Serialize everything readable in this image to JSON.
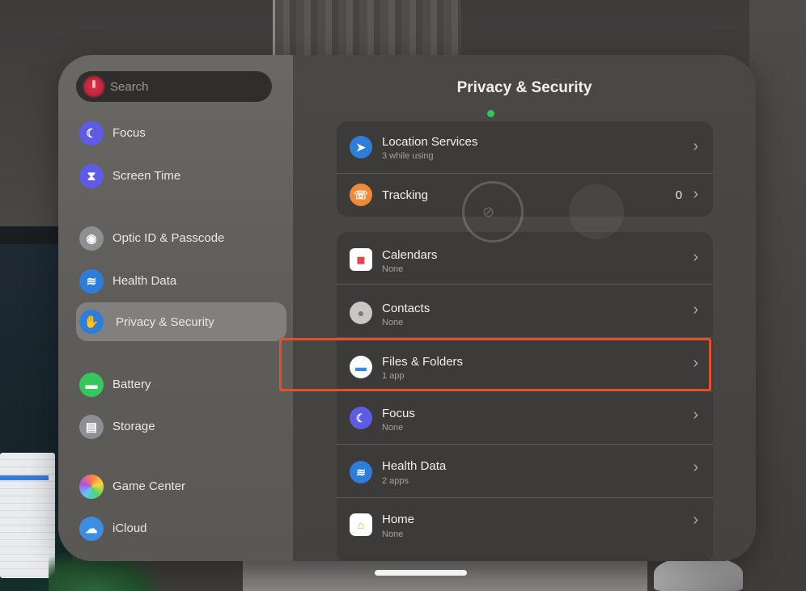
{
  "search": {
    "placeholder": "Search"
  },
  "sidebar": {
    "items": [
      {
        "label": "Focus",
        "icon": "moon-icon",
        "color": "#5e5ce6"
      },
      {
        "label": "Screen Time",
        "icon": "hourglass-icon",
        "color": "#5e5ce6"
      },
      {
        "label": "Optic ID & Passcode",
        "icon": "optic-id-icon",
        "color": "#8e8e93"
      },
      {
        "label": "Health Data",
        "icon": "health-data-icon",
        "color": "#2f7ddb"
      },
      {
        "label": "Privacy & Security",
        "icon": "hand-icon",
        "color": "#2f7ddb",
        "selected": true
      },
      {
        "label": "Battery",
        "icon": "battery-icon",
        "color": "#34c759"
      },
      {
        "label": "Storage",
        "icon": "storage-icon",
        "color": "#8e8e93"
      },
      {
        "label": "Game Center",
        "icon": "game-center-icon",
        "color": "#ff7a45"
      },
      {
        "label": "iCloud",
        "icon": "icloud-icon",
        "color": "#3d8de0"
      }
    ]
  },
  "main": {
    "title": "Privacy & Security",
    "group1": [
      {
        "title": "Location Services",
        "subtitle": "3 while using",
        "icon": "location-arrow-icon",
        "color": "#2f7ddb"
      },
      {
        "title": "Tracking",
        "value": "0",
        "icon": "tracking-icon",
        "color": "#f08a3a"
      }
    ],
    "group2": [
      {
        "title": "Calendars",
        "subtitle": "None",
        "icon": "calendar-icon"
      },
      {
        "title": "Contacts",
        "subtitle": "None",
        "icon": "contacts-icon"
      },
      {
        "title": "Files & Folders",
        "subtitle": "1 app",
        "icon": "folder-icon",
        "highlighted": true
      },
      {
        "title": "Focus",
        "subtitle": "None",
        "icon": "moon-icon",
        "color": "#5e5ce6"
      },
      {
        "title": "Health Data",
        "subtitle": "2 apps",
        "icon": "health-data-icon",
        "color": "#2f7ddb"
      },
      {
        "title": "Home",
        "subtitle": "None",
        "icon": "home-icon",
        "color": "#f5a623"
      }
    ]
  },
  "colors": {
    "highlight": "#e2512b",
    "accent": "#34c759"
  }
}
